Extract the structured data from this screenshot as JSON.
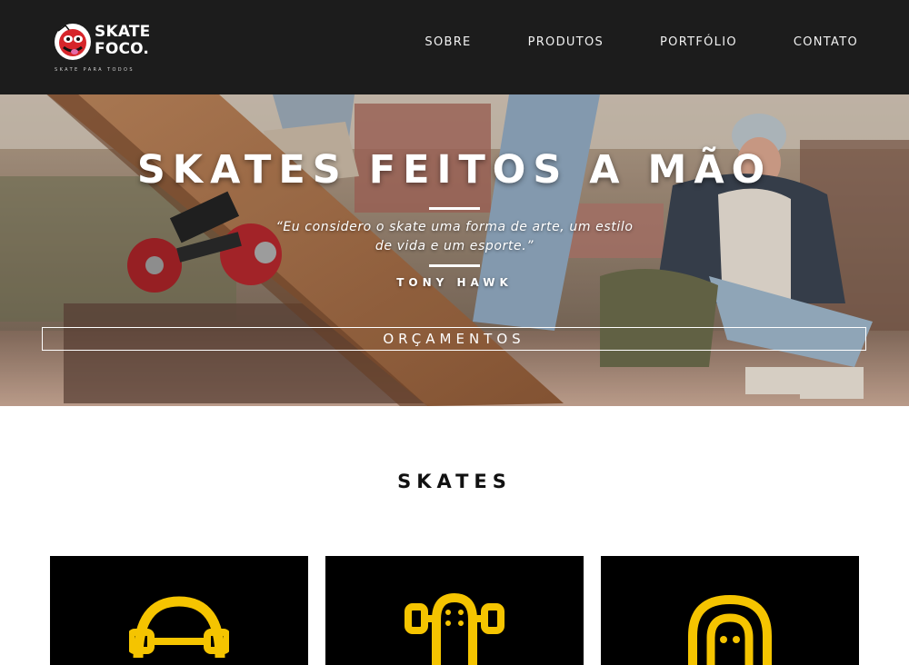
{
  "header": {
    "logo": {
      "title": "SKATE\nFOCO.",
      "tagline": "SKATE PARA TODOS"
    },
    "nav": [
      {
        "label": "SOBRE"
      },
      {
        "label": "PRODUTOS"
      },
      {
        "label": "PORTFÓLIO"
      },
      {
        "label": "CONTATO"
      }
    ]
  },
  "hero": {
    "title": "SKATES FEITOS A MÃO",
    "quote": "“Eu considero o skate uma forma de arte, um estilo de vida e um esporte.”",
    "author": "TONY HAWK",
    "cta_label": "ORÇAMENTOS"
  },
  "products": {
    "title": "SKATES",
    "cards": [
      {
        "icon": "skateboard-icon"
      },
      {
        "icon": "skateboard-trucks-icon"
      },
      {
        "icon": "helmet-icon"
      }
    ]
  },
  "colors": {
    "header_bg": "#1c1c1c",
    "accent": "#f5c400",
    "card_bg": "#000000"
  }
}
